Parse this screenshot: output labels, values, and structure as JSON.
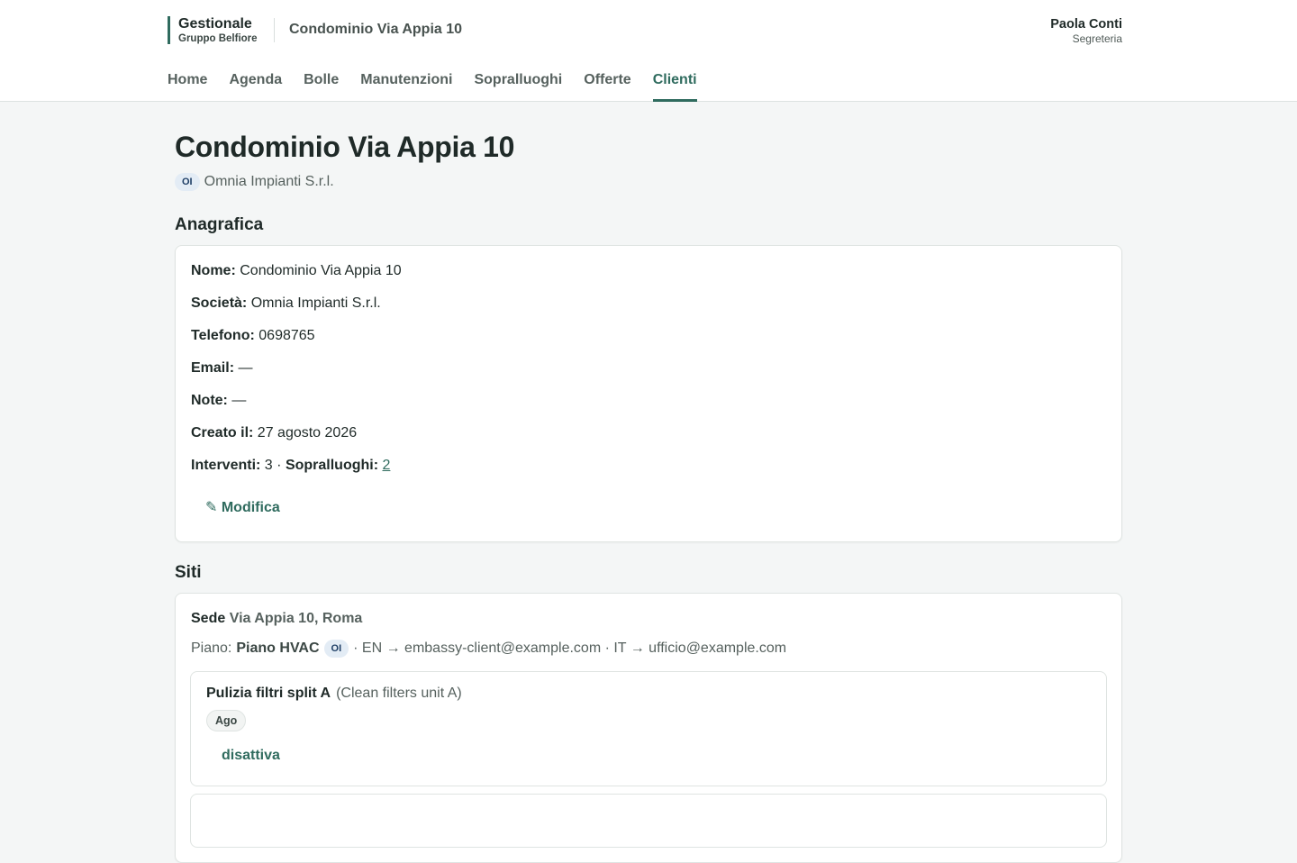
{
  "header": {
    "brand_title": "Gestionale",
    "brand_subtitle": "Gruppo Belfiore",
    "context_title": "Condominio Via Appia 10",
    "user_name": "Paola Conti",
    "user_role": "Segreteria"
  },
  "nav": {
    "items": [
      {
        "label": "Home"
      },
      {
        "label": "Agenda"
      },
      {
        "label": "Bolle"
      },
      {
        "label": "Manutenzioni"
      },
      {
        "label": "Sopralluoghi"
      },
      {
        "label": "Offerte"
      },
      {
        "label": "Clienti",
        "active": true
      }
    ]
  },
  "page": {
    "title": "Condominio Via Appia 10",
    "company_badge": "OI",
    "company_name": "Omnia Impianti S.r.l."
  },
  "anagrafica": {
    "section_title": "Anagrafica",
    "nome_label": "Nome:",
    "nome_value": "Condominio Via Appia 10",
    "societa_label": "Società:",
    "societa_value": "Omnia Impianti S.r.l.",
    "telefono_label": "Telefono:",
    "telefono_value": "0698765",
    "email_label": "Email:",
    "email_value": "—",
    "note_label": "Note:",
    "note_value": "—",
    "creato_label": "Creato il:",
    "creato_value": "27 agosto 2026",
    "interventi_label": "Interventi:",
    "interventi_value": "3",
    "separator": "·",
    "sopralluoghi_label": "Sopralluoghi:",
    "sopralluoghi_value": "2",
    "edit_label": "✎ Modifica"
  },
  "siti": {
    "section_title": "Siti",
    "site_label": "Sede",
    "site_address": "Via Appia 10, Roma",
    "piano_label": "Piano:",
    "piano_name": "Piano HVAC",
    "piano_badge": "OI",
    "piano_routing": "· EN → embassy-client@example.com · IT → ufficio@example.com",
    "task": {
      "title": "Pulizia filtri split A",
      "title_en": "(Clean filters unit A)",
      "month": "Ago",
      "disable_label": "disattiva"
    }
  },
  "colors": {
    "accent": "#2f6b5e",
    "background": "#f4f6f6",
    "badge_bg": "#e3ecf5"
  }
}
